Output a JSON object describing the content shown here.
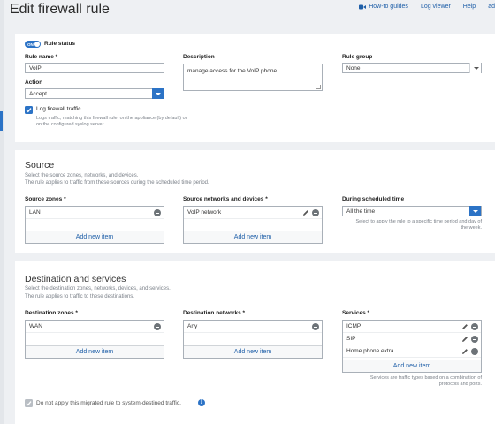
{
  "page": {
    "title": "Edit firewall rule"
  },
  "top_links": {
    "howto": "How-to guides",
    "logviewer": "Log viewer",
    "help": "Help",
    "extra": "ad"
  },
  "rule": {
    "status_label": "Rule status",
    "toggle_text": "ON",
    "name_label": "Rule name *",
    "name_value": "VoIP",
    "description_label": "Description",
    "description_value": "manage access for the VoIP phone",
    "group_label": "Rule group",
    "group_value": "None",
    "action_label": "Action",
    "action_value": "Accept",
    "log_label": "Log firewall traffic",
    "log_help": "Logs traffic, matching this firewall rule, on the appliance (by default) or on the configured syslog server."
  },
  "source": {
    "title": "Source",
    "desc1": "Select the source zones, networks, and devices.",
    "desc2": "The rule applies to traffic from these sources during the scheduled time period.",
    "zones_label": "Source zones *",
    "zones": [
      "LAN"
    ],
    "networks_label": "Source networks and devices *",
    "networks": [
      "VoIP network"
    ],
    "add_label": "Add new item",
    "schedule_label": "During scheduled time",
    "schedule_value": "All the time",
    "schedule_help": "Select to apply the rule to a specific time period and day of the week."
  },
  "destination": {
    "title": "Destination and services",
    "desc1": "Select the destination zones, networks, devices, and services.",
    "desc2": "The rule applies to traffic to these destinations.",
    "zones_label": "Destination zones *",
    "zones": [
      "WAN"
    ],
    "networks_label": "Destination networks *",
    "networks": [
      "Any"
    ],
    "services_label": "Services *",
    "services": [
      "ICMP",
      "SIP",
      "Home phone extra"
    ],
    "add_label": "Add new item",
    "services_help": "Services are traffic types based on a combination of protocols and ports.",
    "migrated_label": "Do not apply this migrated rule to system-destined traffic."
  },
  "colors": {
    "accent": "#2c73c6",
    "link": "#1f5fa8",
    "background": "#eef0f3"
  }
}
